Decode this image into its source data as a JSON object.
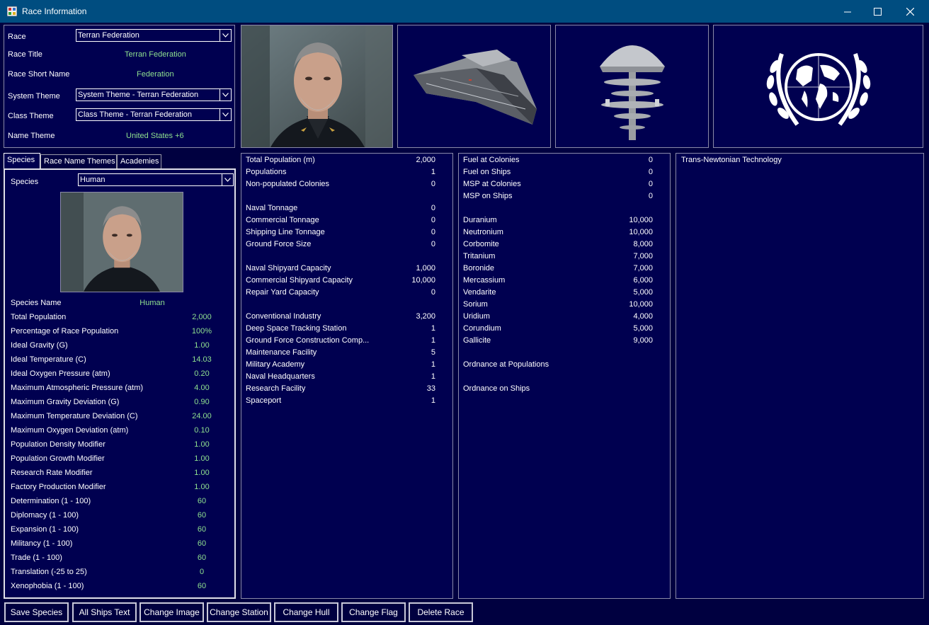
{
  "window": {
    "title": "Race Information"
  },
  "header": {
    "race_label": "Race",
    "race_value": "Terran Federation",
    "race_title_label": "Race Title",
    "race_title_value": "Terran Federation",
    "short_name_label": "Race Short Name",
    "short_name_value": "Federation",
    "system_theme_label": "System Theme",
    "system_theme_value": "System Theme - Terran Federation",
    "class_theme_label": "Class Theme",
    "class_theme_value": "Class Theme - Terran Federation",
    "name_theme_label": "Name Theme",
    "name_theme_value": "United States +6"
  },
  "tabs": [
    "Species",
    "Race Name Themes",
    "Academies"
  ],
  "species": {
    "label": "Species",
    "value": "Human",
    "rows": [
      {
        "label": "Species Name",
        "value": "Human"
      },
      {
        "label": "Total Population",
        "value": "2,000"
      },
      {
        "label": "Percentage of Race Population",
        "value": "100%"
      },
      {
        "label": "Ideal Gravity (G)",
        "value": "1.00"
      },
      {
        "label": "Ideal Temperature (C)",
        "value": "14.03"
      },
      {
        "label": "Ideal Oxygen Pressure (atm)",
        "value": "0.20"
      },
      {
        "label": "Maximum Atmospheric Pressure (atm)",
        "value": "4.00"
      },
      {
        "label": "Maximum Gravity Deviation (G)",
        "value": "0.90"
      },
      {
        "label": "Maximum Temperature Deviation (C)",
        "value": "24.00"
      },
      {
        "label": "Maximum Oxygen Deviation (atm)",
        "value": "0.10"
      },
      {
        "label": "Population Density Modifier",
        "value": "1.00"
      },
      {
        "label": "Population Growth Modifier",
        "value": "1.00"
      },
      {
        "label": "Research Rate Modifier",
        "value": "1.00"
      },
      {
        "label": "Factory Production Modifier",
        "value": "1.00"
      },
      {
        "label": "Determination (1 - 100)",
        "value": "60"
      },
      {
        "label": "Diplomacy (1 - 100)",
        "value": "60"
      },
      {
        "label": "Expansion (1 - 100)",
        "value": "60"
      },
      {
        "label": "Militancy (1 - 100)",
        "value": "60"
      },
      {
        "label": "Trade (1 - 100)",
        "value": "60"
      },
      {
        "label": "Translation (-25 to 25)",
        "value": "0"
      },
      {
        "label": "Xenophobia (1 - 100)",
        "value": "60"
      }
    ]
  },
  "stats": [
    {
      "label": "Total Population (m)",
      "value": "2,000"
    },
    {
      "label": "Populations",
      "value": "1"
    },
    {
      "label": "Non-populated Colonies",
      "value": "0"
    },
    {
      "label": "",
      "value": ""
    },
    {
      "label": "Naval Tonnage",
      "value": "0"
    },
    {
      "label": "Commercial Tonnage",
      "value": "0"
    },
    {
      "label": "Shipping Line Tonnage",
      "value": "0"
    },
    {
      "label": "Ground Force Size",
      "value": "0"
    },
    {
      "label": "",
      "value": ""
    },
    {
      "label": "Naval Shipyard Capacity",
      "value": "1,000"
    },
    {
      "label": "Commercial Shipyard Capacity",
      "value": "10,000"
    },
    {
      "label": "Repair Yard Capacity",
      "value": "0"
    },
    {
      "label": "",
      "value": ""
    },
    {
      "label": "Conventional Industry",
      "value": "3,200"
    },
    {
      "label": "Deep Space Tracking Station",
      "value": "1"
    },
    {
      "label": "Ground Force Construction Comp...",
      "value": "1"
    },
    {
      "label": "Maintenance Facility",
      "value": "5"
    },
    {
      "label": "Military Academy",
      "value": "1"
    },
    {
      "label": "Naval Headquarters",
      "value": "1"
    },
    {
      "label": "Research Facility",
      "value": "33"
    },
    {
      "label": "Spaceport",
      "value": "1"
    }
  ],
  "resources": [
    {
      "label": "Fuel at Colonies",
      "value": "0"
    },
    {
      "label": "Fuel on Ships",
      "value": "0"
    },
    {
      "label": "MSP at Colonies",
      "value": "0"
    },
    {
      "label": "MSP on Ships",
      "value": "0"
    },
    {
      "label": "",
      "value": ""
    },
    {
      "label": "Duranium",
      "value": "10,000"
    },
    {
      "label": "Neutronium",
      "value": "10,000"
    },
    {
      "label": "Corbomite",
      "value": "8,000"
    },
    {
      "label": "Tritanium",
      "value": "7,000"
    },
    {
      "label": "Boronide",
      "value": "7,000"
    },
    {
      "label": "Mercassium",
      "value": "6,000"
    },
    {
      "label": "Vendarite",
      "value": "5,000"
    },
    {
      "label": "Sorium",
      "value": "10,000"
    },
    {
      "label": "Uridium",
      "value": "4,000"
    },
    {
      "label": "Corundium",
      "value": "5,000"
    },
    {
      "label": "Gallicite",
      "value": "9,000"
    },
    {
      "label": "",
      "value": ""
    },
    {
      "label": "Ordnance at Populations",
      "value": ""
    },
    {
      "label": "",
      "value": ""
    },
    {
      "label": "Ordnance on Ships",
      "value": ""
    }
  ],
  "technology": [
    "Trans-Newtonian Technology"
  ],
  "buttons": [
    "Save Species",
    "All Ships Text",
    "Change Image",
    "Change Station",
    "Change Hull",
    "Change Flag",
    "Delete Race"
  ],
  "colors": {
    "background": "#000040",
    "titlebar": "#004d80",
    "accent_text": "#8fe08f"
  }
}
